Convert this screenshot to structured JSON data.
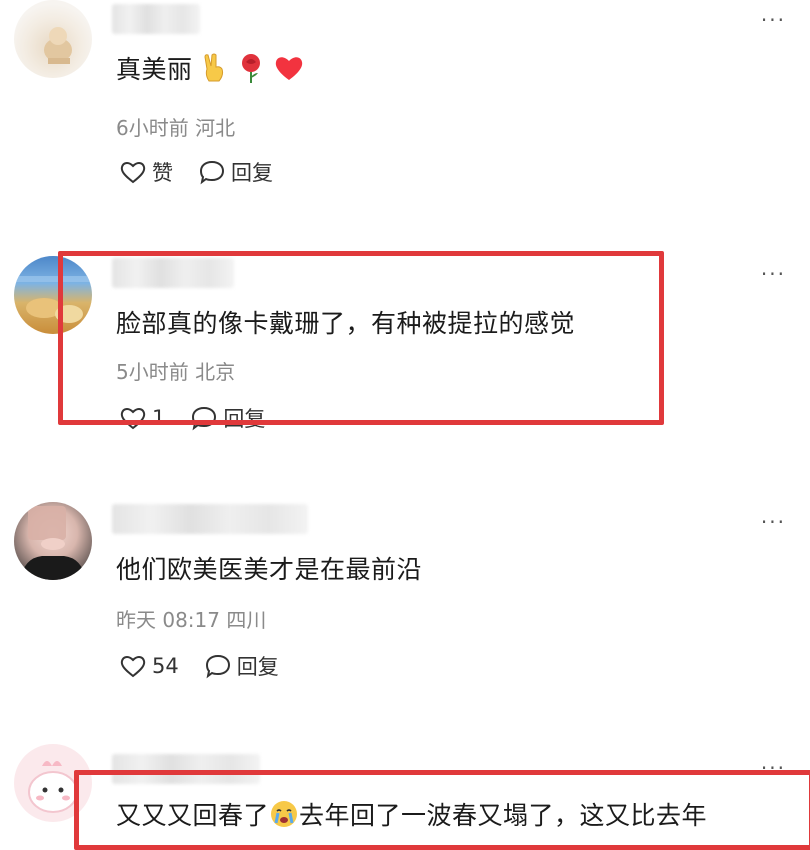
{
  "comments": [
    {
      "text": "真美丽",
      "emojis": [
        "victory-hand",
        "rose",
        "red-heart"
      ],
      "meta": "6小时前 河北",
      "likes": "赞",
      "reply": "回复"
    },
    {
      "text": "脸部真的像卡戴珊了，有种被提拉的感觉",
      "meta": "5小时前 北京",
      "likes": "1",
      "reply": "回复",
      "highlighted": true
    },
    {
      "text": "他们欧美医美才是在最前沿",
      "meta": "昨天 08:17 四川",
      "likes": "54",
      "reply": "回复"
    },
    {
      "text_before": "又又又回春了",
      "text_after": "去年回了一波春又塌了，这又比去年",
      "emoji": "crying-face",
      "highlighted": true
    }
  ],
  "more_label": "···",
  "highlight_color": "#e0393b"
}
